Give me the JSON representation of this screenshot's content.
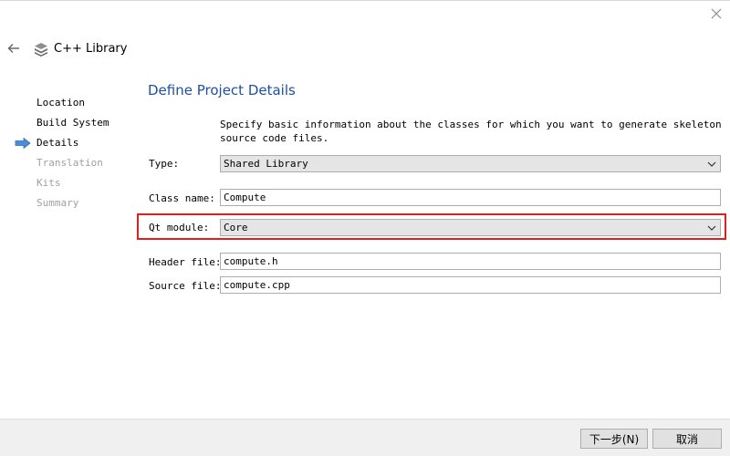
{
  "window": {
    "title": "C++ Library"
  },
  "steps": [
    {
      "label": "Location",
      "state": "done"
    },
    {
      "label": "Build System",
      "state": "done"
    },
    {
      "label": "Details",
      "state": "current"
    },
    {
      "label": "Translation",
      "state": "pending"
    },
    {
      "label": "Kits",
      "state": "pending"
    },
    {
      "label": "Summary",
      "state": "pending"
    }
  ],
  "page": {
    "title": "Define Project Details",
    "description": "Specify basic information about the classes for which you want to generate skeleton source code files."
  },
  "form": {
    "type": {
      "label": "Type:",
      "value": "Shared Library"
    },
    "class_name": {
      "label": "Class name:",
      "value": "Compute"
    },
    "qt_module": {
      "label": "Qt module:",
      "value": "Core"
    },
    "header_file": {
      "label": "Header file:",
      "value": "compute.h"
    },
    "source_file": {
      "label": "Source file:",
      "value": "compute.cpp"
    }
  },
  "footer": {
    "next_label": "下一步(N)",
    "cancel_label": "取消"
  },
  "colors": {
    "accent_title": "#1e4fa3",
    "highlight": "#e02020",
    "current_step_arrow": "#4a8fd6"
  },
  "icons": {
    "close": "close-icon",
    "back": "back-arrow-icon",
    "app": "library-icon",
    "current_step": "current-step-arrow-icon",
    "dropdown": "chevron-down-icon"
  }
}
